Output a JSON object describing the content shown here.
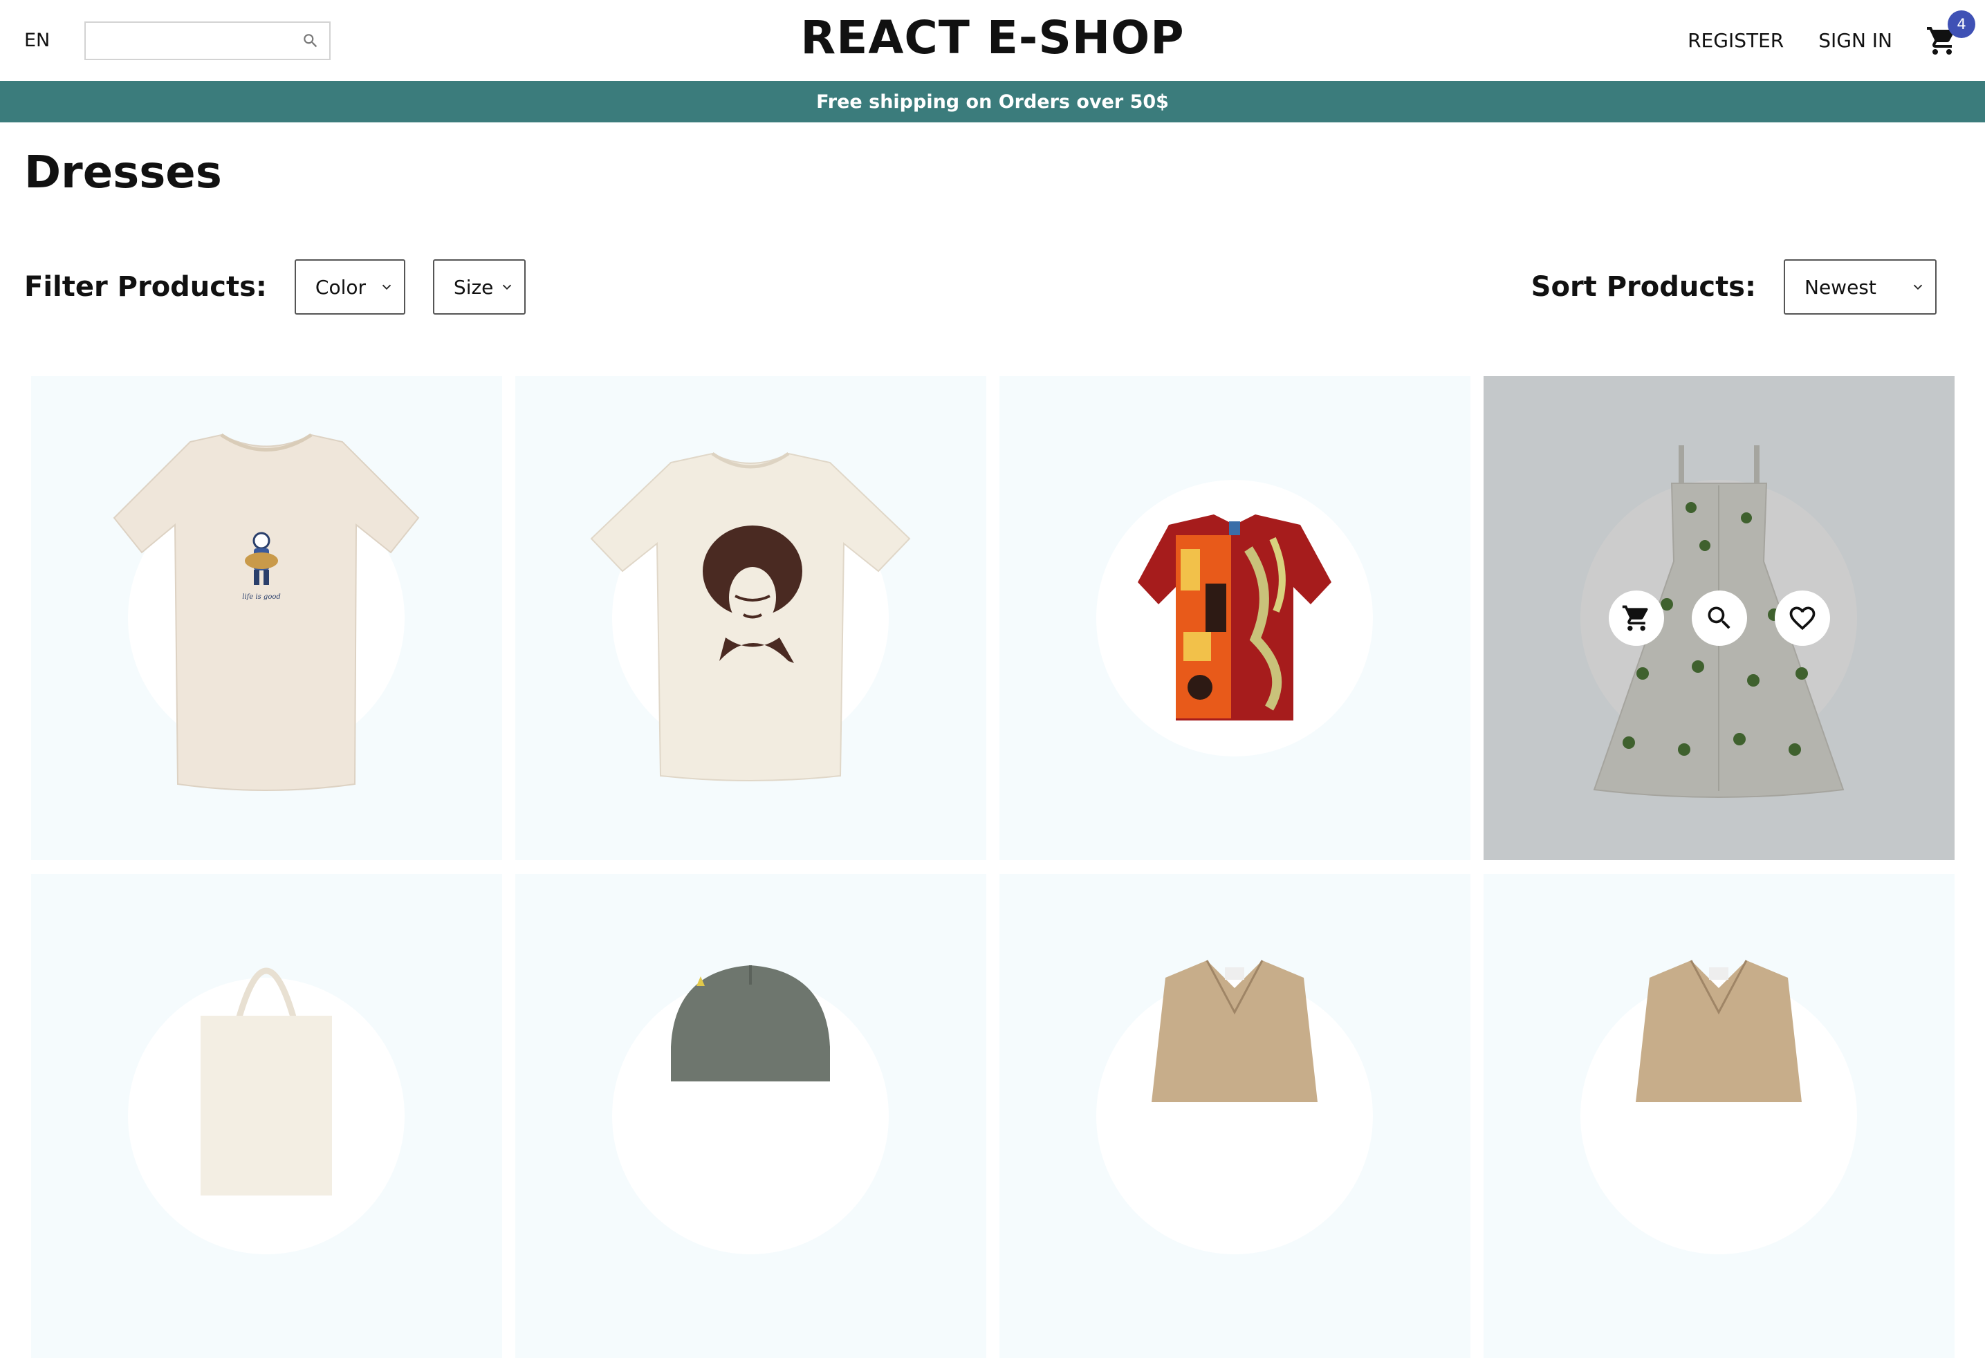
{
  "navbar": {
    "language": "EN",
    "search": {
      "value": "",
      "icon": "search-icon"
    },
    "logo": "REACT E-SHOP",
    "menu": {
      "register": "REGISTER",
      "sign_in": "SIGN IN"
    },
    "cart": {
      "icon": "shopping-cart-icon",
      "badge_count": "4"
    }
  },
  "announcement": "Free shipping on Orders over 50$",
  "page_title": "Dresses",
  "filters": {
    "label": "Filter Products:",
    "color_select": "Color",
    "size_select": "Size",
    "sort_label": "Sort Products:",
    "sort_select": "Newest"
  },
  "products": [
    {
      "name": "life-is-good-tshirt",
      "hovered": false
    },
    {
      "name": "portrait-tshirt",
      "hovered": false
    },
    {
      "name": "printed-shirt",
      "hovered": false
    },
    {
      "name": "floral-dress",
      "hovered": true,
      "actions": [
        "shopping-cart-icon",
        "search-icon",
        "heart-icon"
      ]
    },
    {
      "name": "tote-bag",
      "hovered": false
    },
    {
      "name": "grey-cap",
      "hovered": false
    },
    {
      "name": "trench-coat",
      "hovered": false
    },
    {
      "name": "trench-coat",
      "hovered": false
    }
  ],
  "colors": {
    "announcement_bg": "#3b7c7c",
    "card_bg": "#f5fbfd",
    "badge": "#3f51b5"
  }
}
